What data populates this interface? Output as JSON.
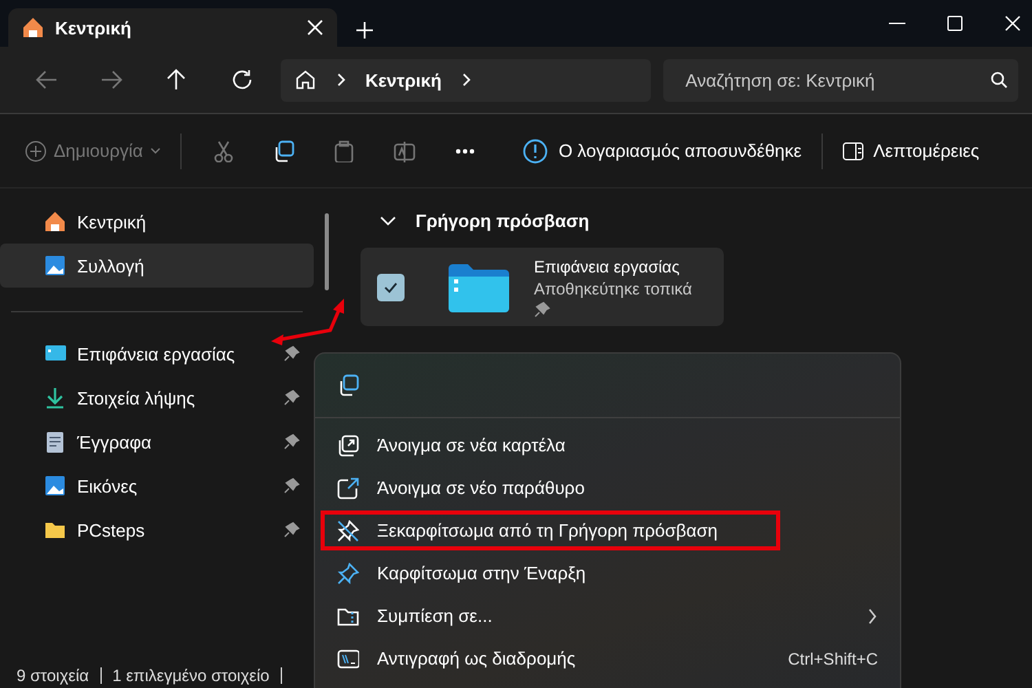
{
  "window": {
    "tabs": [
      {
        "title": "Κεντρική",
        "selected": true
      }
    ]
  },
  "nav": {
    "breadcrumb": [
      "Κεντρική"
    ],
    "search": {
      "placeholder": "Αναζήτηση σε: Κεντρική"
    }
  },
  "toolbar": {
    "new": {
      "label": "Δημιουργία",
      "disabled": true
    },
    "actions": [
      {
        "kind": "cut",
        "disabled": true
      },
      {
        "kind": "copy",
        "disabled": false
      },
      {
        "kind": "paste",
        "disabled": true
      },
      {
        "kind": "rename",
        "disabled": true
      },
      {
        "kind": "more",
        "disabled": false
      }
    ],
    "account_notice": "Ο λογαριασμός αποσυνδέθηκε",
    "details": "Λεπτομέρειες"
  },
  "sidebar": {
    "top_items": [
      {
        "label": "Κεντρική",
        "kind": "home",
        "selected": false
      },
      {
        "label": "Συλλογή",
        "kind": "gallery",
        "selected": true
      }
    ],
    "pinned_items": [
      {
        "label": "Επιφάνεια εργασίας",
        "kind": "desktop",
        "selected": false
      },
      {
        "label": "Στοιχεία λήψης",
        "kind": "downloads",
        "selected": false
      },
      {
        "label": "Έγγραφα",
        "kind": "documents",
        "selected": false
      },
      {
        "label": "Εικόνες",
        "kind": "pictures",
        "selected": false
      },
      {
        "label": "PCsteps",
        "kind": "folder",
        "selected": false
      }
    ]
  },
  "content": {
    "section": {
      "title": "Γρήγορη πρόσβαση",
      "expanded": true
    },
    "tiles": [
      {
        "name": "Επιφάνεια εργασίας",
        "subtitle": "Αποθηκεύτηκε τοπικά",
        "checked": true,
        "pinned": true
      }
    ]
  },
  "context_menu": {
    "top_actions": [
      {
        "kind": "copy"
      }
    ],
    "items": [
      {
        "kind": "new-tab",
        "label": "Άνοιγμα σε νέα καρτέλα",
        "highlighted": false,
        "submenu": false
      },
      {
        "kind": "new-window",
        "label": "Άνοιγμα σε νέο παράθυρο",
        "highlighted": false,
        "submenu": false
      },
      {
        "kind": "unpin",
        "label": "Ξεκαρφίτσωμα από τη Γρήγορη πρόσβαση",
        "highlighted": true,
        "submenu": false
      },
      {
        "kind": "pin",
        "label": "Καρφίτσωμα στην Έναρξη",
        "highlighted": false,
        "submenu": false
      },
      {
        "kind": "zip",
        "label": "Συμπίεση σε...",
        "highlighted": false,
        "submenu": true
      },
      {
        "kind": "copy-path",
        "label": "Αντιγραφή ως διαδρομής",
        "highlighted": false,
        "submenu": false,
        "shortcut": "Ctrl+Shift+C"
      }
    ]
  },
  "status_bar": [
    "9 στοιχεία",
    "1 επιλεγμένο στοιχείο"
  ]
}
